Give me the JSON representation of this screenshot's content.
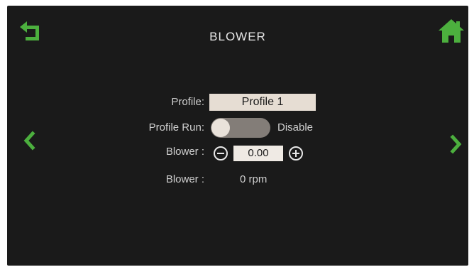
{
  "header": {
    "title": "BLOWER",
    "back_icon": "back-arrow-icon",
    "home_icon": "home-icon"
  },
  "navigation": {
    "prev_icon": "chevron-left-icon",
    "next_icon": "chevron-right-icon"
  },
  "form": {
    "profile_label": "Profile:",
    "profile_value": "Profile 1",
    "profile_run_label": "Profile Run:",
    "profile_run_state": "Disable",
    "profile_run_on": false,
    "blower_setpoint_label": "Blower :",
    "blower_setpoint_value": "0.00",
    "blower_speed_label": "Blower :",
    "blower_speed_value": "0 rpm"
  },
  "colors": {
    "accent": "#4caf3e",
    "background": "#1a1a1a",
    "field": "#e6ddd3",
    "text": "#d0d0d0"
  }
}
